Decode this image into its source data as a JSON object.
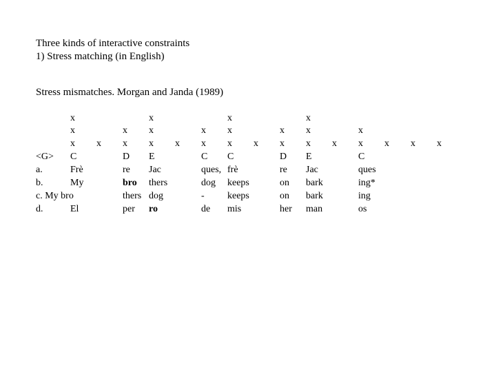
{
  "title": {
    "line1": "Three kinds of interactive constraints",
    "line2": "1) Stress matching (in English)"
  },
  "subheading": "Stress mismatches. Morgan and Janda (1989)",
  "grid": {
    "row1": [
      "",
      "x",
      "",
      "",
      "x",
      "",
      "",
      "x",
      "",
      "",
      "x",
      "",
      "",
      "",
      "",
      ""
    ],
    "row2": [
      "",
      "x",
      "",
      "x",
      "x",
      "",
      "x",
      "x",
      "",
      "x",
      "x",
      "",
      "x",
      "",
      "",
      ""
    ],
    "row3": [
      "",
      "x",
      "x",
      "x",
      "x",
      "x",
      "x",
      "x",
      "x",
      "x",
      "x",
      "x",
      "x",
      "x",
      "x",
      "x"
    ],
    "row4": [
      "<G>",
      "C",
      "",
      "D",
      "E",
      "",
      "C",
      "C",
      "",
      "D",
      "E",
      "",
      "C",
      "",
      "",
      ""
    ],
    "row5": [
      "a.",
      "Frè",
      "",
      "re",
      "Jac",
      "",
      "ques,",
      "frè",
      "",
      "re",
      "Jac",
      "",
      "ques",
      "",
      "",
      ""
    ],
    "row6": [
      "b.",
      "My",
      "",
      "bro",
      "thers",
      "",
      "dog",
      "keeps",
      "",
      "on",
      "bark",
      "",
      "ing*",
      "",
      "",
      ""
    ],
    "row7": [
      "c. My bro",
      "",
      "",
      "thers",
      "dog",
      "",
      "-",
      "keeps",
      "",
      "on",
      "bark",
      "",
      "ing",
      "",
      "",
      ""
    ],
    "row8": [
      "d.",
      "El",
      "",
      "per",
      "ro",
      "",
      "de",
      "mis",
      "",
      "her",
      "man",
      "",
      "os",
      "",
      "",
      ""
    ],
    "bold": {
      "row6": [
        3
      ],
      "row8": [
        4
      ]
    }
  }
}
